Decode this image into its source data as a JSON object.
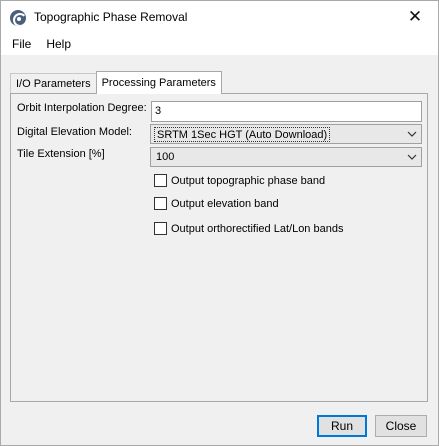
{
  "window": {
    "title": "Topographic Phase Removal",
    "app_icon": "snap-app-icon",
    "close_glyph": "✕"
  },
  "menu": {
    "items": [
      "File",
      "Help"
    ]
  },
  "tabs": [
    {
      "label": "I/O Parameters",
      "active": false
    },
    {
      "label": "Processing Parameters",
      "active": true
    }
  ],
  "form": {
    "orbit_label": "Orbit Interpolation Degree:",
    "orbit_value": "3",
    "dem_label": "Digital Elevation Model:",
    "dem_value": "SRTM 1Sec HGT (Auto Download)",
    "tile_label": "Tile Extension [%]",
    "tile_value": "100"
  },
  "checkboxes": [
    {
      "label": "Output topographic phase band",
      "checked": false
    },
    {
      "label": "Output elevation band",
      "checked": false
    },
    {
      "label": "Output orthorectified Lat/Lon bands",
      "checked": false
    }
  ],
  "buttons": {
    "run": "Run",
    "close": "Close"
  },
  "colors": {
    "focus_border": "#0078d7",
    "dialog_bg": "#f0f0f0"
  }
}
